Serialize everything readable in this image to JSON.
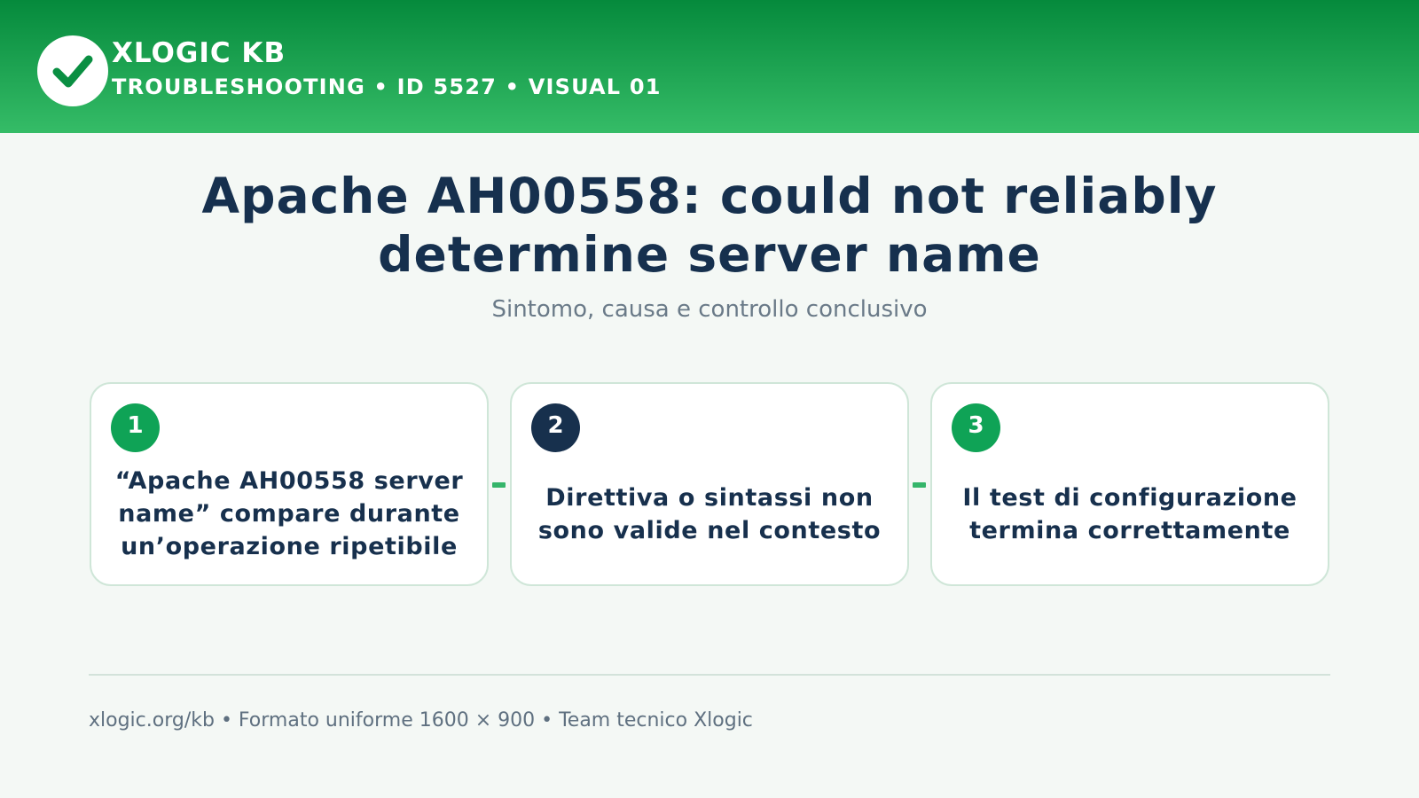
{
  "header": {
    "brand": "XLOGIC KB",
    "subtitle": "TROUBLESHOOTING • ID 5527 • VISUAL 01",
    "logo_icon": "checkmark-icon"
  },
  "main": {
    "title": "Apache AH00558: could not reliably determine server name",
    "subtitle": "Sintomo, causa e controllo conclusivo"
  },
  "steps": [
    {
      "number": "1",
      "text": "“Apache AH00558 server name” compare durante un’operazione ripetibile",
      "badge_color": "#0fa356"
    },
    {
      "number": "2",
      "text": "Direttiva o sintassi non sono valide nel contesto",
      "badge_color": "#17304d"
    },
    {
      "number": "3",
      "text": "Il test di configurazione termina correttamente",
      "badge_color": "#0fa356"
    }
  ],
  "footer": {
    "text": "xlogic.org/kb • Formato uniforme 1600 × 900 • Team tecnico Xlogic"
  },
  "colors": {
    "header_dark": "#058a3c",
    "header_light": "#35bc67",
    "accent_green": "#0fa356",
    "navy": "#17304d",
    "background": "#f4f8f5"
  }
}
